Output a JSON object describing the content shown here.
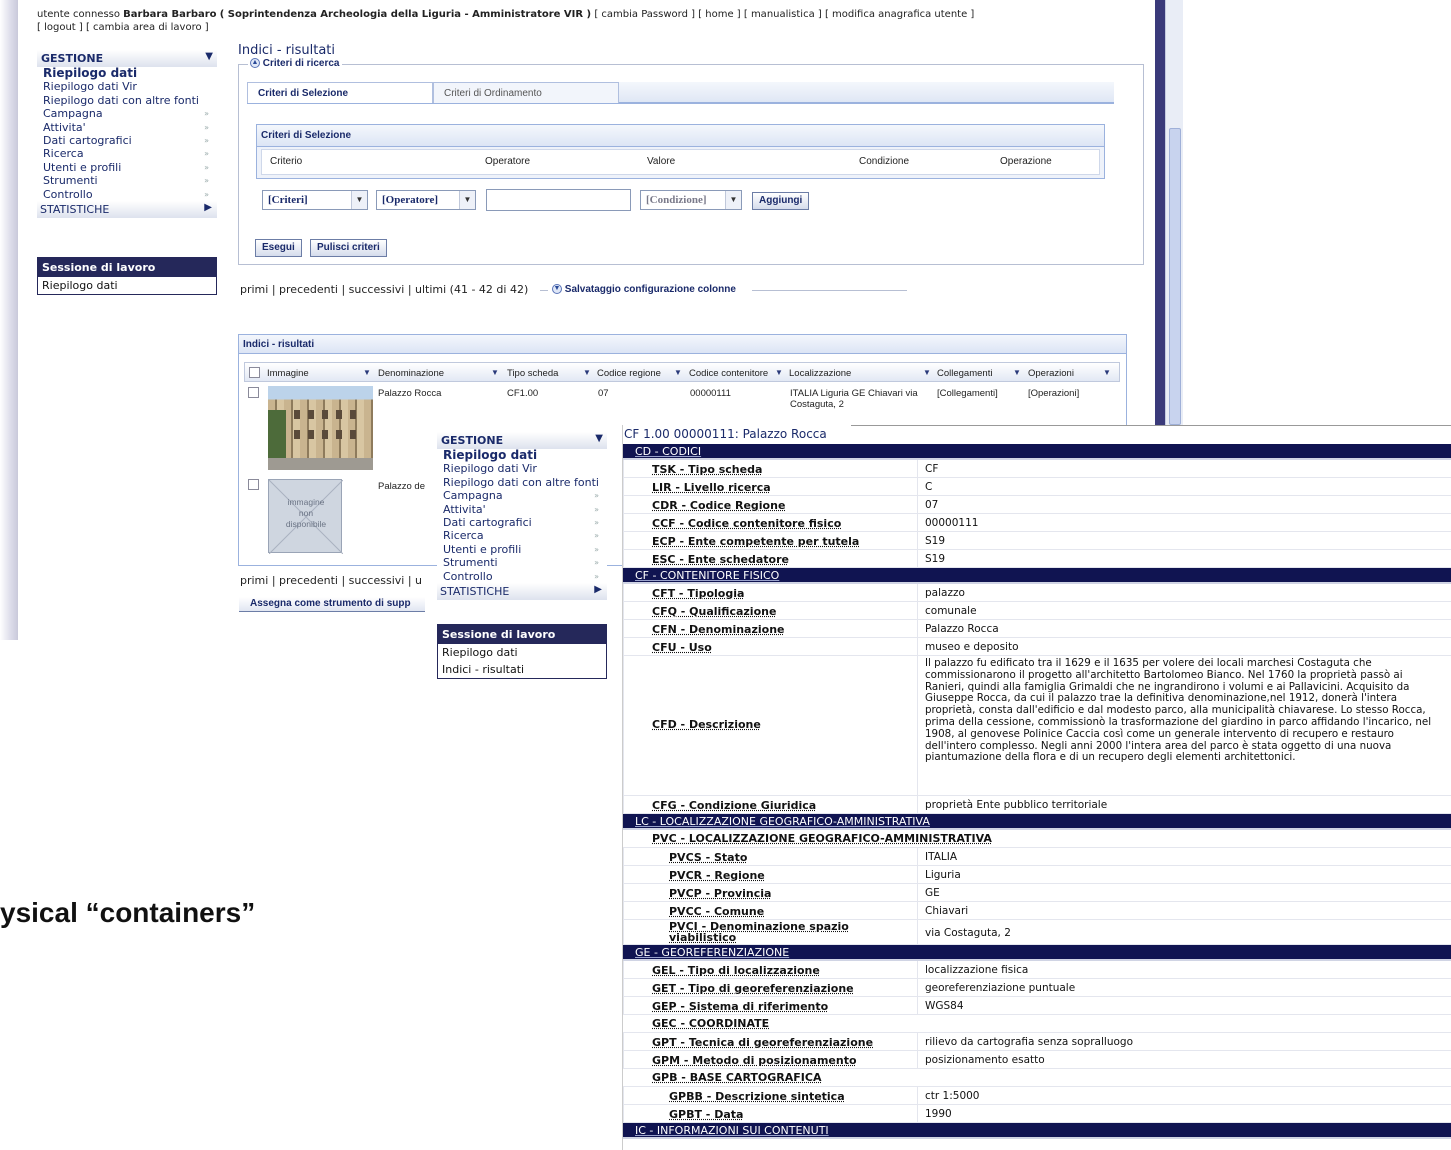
{
  "user_bar": {
    "prefix": "utente connesso",
    "user": "Barbara Barbaro",
    "org": "( Soprintendenza Archeologia della Liguria - Amministratore VIR )",
    "links": "[ cambia Password ] [ home ] [ manualistica ] [ modifica anagrafica utente ]",
    "line2": "[ logout ] [ cambia area di lavoro ]"
  },
  "menu": {
    "head": "GESTIONE",
    "items": [
      "Riepilogo dati",
      "Riepilogo dati Vir",
      "Riepilogo dati con altre fonti",
      "Campagna",
      "Attivita'",
      "Dati cartografici",
      "Ricerca",
      "Utenti e profili",
      "Strumenti",
      "Controllo"
    ],
    "stat": "STATISTICHE"
  },
  "session": {
    "head": "Sessione di lavoro",
    "items_bg": [
      "Riepilogo dati"
    ],
    "items_overlay": [
      "Riepilogo dati",
      "Indici - risultati"
    ]
  },
  "page": {
    "title": "Indici - risultati",
    "criteria_legend": "Criteri di ricerca",
    "tabs": [
      "Criteri di Selezione",
      "Criteri di Ordinamento"
    ],
    "crit_header": "Criteri di Selezione",
    "crit_cols": [
      "Criterio",
      "Operatore",
      "Valore",
      "Condizione",
      "Operazione"
    ],
    "select_criteri": "[Criteri]",
    "select_operatore": "[Operatore]",
    "select_condizione": "[Condizione]",
    "btn_aggiungi": "Aggiungi",
    "btn_esegui": "Esegui",
    "btn_pulisci": "Pulisci criteri",
    "pager": "primi | precedenti | successivi | ultimi (41 - 42 di 42)",
    "pager_short": "primi | precedenti | successivi | u",
    "save_conf": "Salvataggio configurazione colonne",
    "assign_btn": "Assegna come strumento di supp"
  },
  "grid": {
    "header": "Indici - risultati",
    "columns": [
      "Immagine",
      "Denominazione",
      "Tipo scheda",
      "Codice regione",
      "Codice contenitore",
      "Localizzazione",
      "Collegamenti",
      "Operazioni"
    ],
    "row1": {
      "denominazione": "Palazzo Rocca",
      "tipo": "CF1.00",
      "regione": "07",
      "contenitore": "00000111",
      "loc1": "ITALIA Liguria GE Chiavari via",
      "loc2": "Costaguta, 2",
      "collegamenti": "[Collegamenti]",
      "operazioni": "[Operazioni]"
    },
    "row2": {
      "denominazione": "Palazzo de"
    },
    "no_image": [
      "immagine",
      "non",
      "disponibile"
    ]
  },
  "big_text": "ysical “containers”",
  "card": {
    "title": "CF 1.00 00000111: Palazzo Rocca",
    "rows": [
      {
        "t": "sec",
        "k": "CD - CODICI"
      },
      {
        "t": "row",
        "k": "TSK - Tipo scheda",
        "v": "CF"
      },
      {
        "t": "row",
        "k": "LIR - Livello ricerca",
        "v": "C"
      },
      {
        "t": "row",
        "k": "CDR - Codice Regione",
        "v": "07"
      },
      {
        "t": "row",
        "k": "CCF - Codice contenitore fisico",
        "v": "00000111"
      },
      {
        "t": "row",
        "k": "ECP - Ente competente per tutela",
        "v": "S19"
      },
      {
        "t": "row",
        "k": "ESC - Ente schedatore",
        "v": "S19"
      },
      {
        "t": "sec",
        "k": "CF - CONTENITORE FISICO"
      },
      {
        "t": "row",
        "k": "CFT - Tipologia",
        "v": "palazzo"
      },
      {
        "t": "row",
        "k": "CFQ - Qualificazione",
        "v": "comunale"
      },
      {
        "t": "row",
        "k": "CFN - Denominazione",
        "v": "Palazzo Rocca"
      },
      {
        "t": "row",
        "k": "CFU - Uso",
        "v": "museo e deposito"
      },
      {
        "t": "big",
        "k": "CFD - Descrizione",
        "v": "Il palazzo fu edificato tra il 1629 e il 1635 per volere dei locali marchesi Costaguta che commissionarono il progetto all'architetto Bartolomeo Bianco. Nel 1760 la proprietà passò ai Ranieri, quindi alla famiglia Grimaldi che ne ingrandirono i volumi e ai Pallavicini. Acquisito da Giuseppe Rocca, da cui il palazzo trae la definitiva denominazione,nel 1912, donerà l'intera proprietà, consta dall'edificio e dal modesto parco, alla municipalità chiavarese. Lo stesso Rocca, prima della cessione, commissionò la trasformazione del giardino in parco affidando l'incarico, nel 1908, al genovese Polinice Caccia così come un generale intervento di recupero e restauro dell'intero complesso. Negli anni 2000 l'intera area del parco è stata oggetto di una nuova piantumazione della flora e di un recupero degli elementi architettonici."
      },
      {
        "t": "row",
        "k": "CFG - Condizione Giuridica",
        "v": "proprietà Ente pubblico territoriale"
      },
      {
        "t": "sec",
        "k": "LC - LOCALIZZAZIONE GEOGRAFICO-AMMINISTRATIVA"
      },
      {
        "t": "sub",
        "k": "PVC - LOCALIZZAZIONE GEOGRAFICO-AMMINISTRATIVA"
      },
      {
        "t": "irow",
        "k": "PVCS - Stato",
        "v": "ITALIA"
      },
      {
        "t": "irow",
        "k": "PVCR - Regione",
        "v": "Liguria"
      },
      {
        "t": "irow",
        "k": "PVCP - Provincia",
        "v": "GE"
      },
      {
        "t": "irow",
        "k": "PVCC - Comune",
        "v": "Chiavari"
      },
      {
        "t": "irow2",
        "k": "PVCI - Denominazione spazio viabilistico",
        "v": "via Costaguta, 2"
      },
      {
        "t": "sec",
        "k": "GE - GEOREFERENZIAZIONE"
      },
      {
        "t": "row",
        "k": "GEL - Tipo di localizzazione",
        "v": "localizzazione fisica"
      },
      {
        "t": "row",
        "k": "GET - Tipo di georeferenziazione",
        "v": "georeferenziazione puntuale"
      },
      {
        "t": "row",
        "k": "GEP - Sistema di riferimento",
        "v": "WGS84"
      },
      {
        "t": "subk",
        "k": "GEC - COORDINATE"
      },
      {
        "t": "row",
        "k": "GPT - Tecnica di georeferenziazione",
        "v": "rilievo da cartografia senza sopralluogo"
      },
      {
        "t": "row",
        "k": "GPM - Metodo di posizionamento",
        "v": "posizionamento esatto"
      },
      {
        "t": "subk",
        "k": "GPB - BASE CARTOGRAFICA"
      },
      {
        "t": "irow",
        "k": "GPBB - Descrizione sintetica",
        "v": "ctr 1:5000"
      },
      {
        "t": "irow",
        "k": "GPBT - Data",
        "v": "1990"
      },
      {
        "t": "sec",
        "k": "IC - INFORMAZIONI SUI CONTENUTI"
      }
    ]
  }
}
